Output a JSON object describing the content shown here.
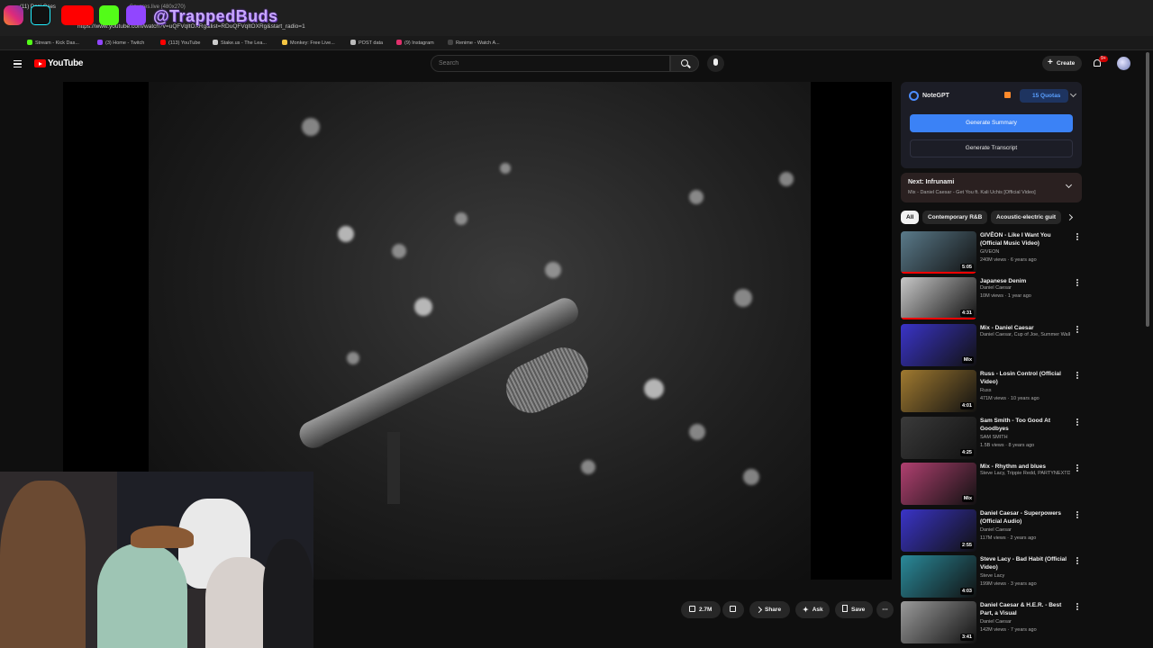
{
  "browser": {
    "tab_title": "(11) Dani Caes",
    "tab_title2": "Squares.live (480x270)",
    "url": "https://www.youtube.com/watch?v=uQFVqltOXRg&list=RDuQFVqltOXRg&start_radio=1",
    "bookmarks": [
      {
        "label": "Stream - Kick Das...",
        "color": "#53fc18"
      },
      {
        "label": "(3) Home - Twitch",
        "color": "#9146ff"
      },
      {
        "label": "(113) YouTube",
        "color": "#ff0000"
      },
      {
        "label": "Stake.us - The Lea...",
        "color": "#cccccc"
      },
      {
        "label": "Monkey: Free Live...",
        "color": "#f5c542"
      },
      {
        "label": "POST data",
        "color": "#bbbbbb"
      },
      {
        "label": "(9) Instagram",
        "color": "#e1306c"
      },
      {
        "label": "Renime - Watch A...",
        "color": "#222222"
      }
    ]
  },
  "overlay": {
    "handle": "@TrappedBuds"
  },
  "youtube": {
    "logo_text": "YouTube",
    "search_placeholder": "Search",
    "create_label": "Create",
    "notifications_badge": "9+"
  },
  "actions": {
    "like_count": "2.7M",
    "share_label": "Share",
    "ask_label": "Ask",
    "save_label": "Save"
  },
  "notegpt": {
    "name": "NoteGPT",
    "quota": "15 Quotas",
    "summary_button": "Generate Summary",
    "transcript_button": "Generate Transcript"
  },
  "next_up": {
    "title": "Next: Infrunami",
    "subtitle": "Mix - Daniel Caesar - Get You ft. Kali Uchis [Official Video]"
  },
  "chips": [
    "All",
    "Contemporary R&B",
    "Acoustic-electric guit"
  ],
  "recommendations": [
    {
      "title": "GIVĒON - Like I Want You (Official Music Video)",
      "channel": "GIVĒON",
      "meta": "240M views · 6 years ago",
      "duration": "5:05",
      "thumb": "#5a7a8a"
    },
    {
      "title": "Japanese Denim",
      "channel": "Daniel Caesar",
      "meta": "10M views · 1 year ago",
      "duration": "4:31",
      "thumb": "#c8c8c8"
    },
    {
      "title": "Mix - Daniel Caesar",
      "channel": "Daniel Caesar, Cup of Joe, Summer Walk...",
      "meta": "",
      "duration": "Mix",
      "thumb": "#3a34c8"
    },
    {
      "title": "Russ - Losin Control (Official Video)",
      "channel": "Russ",
      "meta": "471M views · 10 years ago",
      "duration": "4:01",
      "thumb": "#a07a30"
    },
    {
      "title": "Sam Smith - Too Good At Goodbyes",
      "channel": "SAM SMITH",
      "meta": "1.5B views · 8 years ago",
      "duration": "4:25",
      "thumb": "#3a3a3a"
    },
    {
      "title": "Mix - Rhythm and blues",
      "channel": "Steve Lacy, Trippie Redd, PARTYNEXTDO...",
      "meta": "",
      "duration": "Mix",
      "thumb": "#b04070"
    },
    {
      "title": "Daniel Caesar - Superpowers (Official Audio)",
      "channel": "Daniel Caesar",
      "meta": "117M views · 2 years ago",
      "duration": "2:55",
      "thumb": "#3a34c8"
    },
    {
      "title": "Steve Lacy - Bad Habit (Official Video)",
      "channel": "Steve Lacy",
      "meta": "199M views · 3 years ago",
      "duration": "4:03",
      "thumb": "#2a8a9a"
    },
    {
      "title": "Daniel Caesar & H.E.R. - Best Part, a Visual",
      "channel": "Daniel Caesar",
      "meta": "142M views · 7 years ago",
      "duration": "3:41",
      "thumb": "#9a9a9a"
    }
  ],
  "colors": {
    "background": "#0f0f0f",
    "accent_red": "#ff0000",
    "notegpt_blue": "#3b82f6"
  }
}
